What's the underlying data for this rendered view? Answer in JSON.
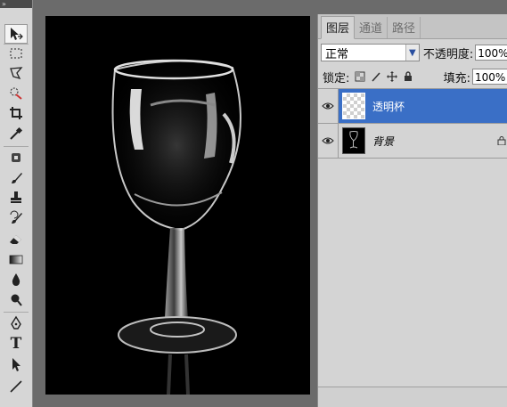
{
  "tools": [
    {
      "icon": "move-icon"
    },
    {
      "icon": "marquee-icon"
    },
    {
      "icon": "lasso-icon"
    },
    {
      "icon": "quick-selection-icon"
    },
    {
      "icon": "crop-icon"
    },
    {
      "icon": "eyedropper-icon"
    },
    {
      "icon": "healing-brush-icon"
    },
    {
      "icon": "brush-icon"
    },
    {
      "icon": "clone-stamp-icon"
    },
    {
      "icon": "history-brush-icon"
    },
    {
      "icon": "eraser-icon"
    },
    {
      "icon": "gradient-icon"
    },
    {
      "icon": "blur-icon"
    },
    {
      "icon": "dodge-icon"
    },
    {
      "icon": "pen-icon"
    },
    {
      "icon": "type-icon"
    },
    {
      "icon": "path-selection-icon"
    },
    {
      "icon": "line-icon"
    }
  ],
  "type_tool_glyph": "T",
  "panel": {
    "tabs": [
      {
        "label": "图层",
        "active": true
      },
      {
        "label": "通道",
        "active": false
      },
      {
        "label": "路径",
        "active": false
      }
    ],
    "blend_mode": "正常",
    "opacity_label": "不透明度:",
    "opacity_value": "100%",
    "lock_label": "锁定:",
    "fill_label": "填充:",
    "fill_value": "100%",
    "layers": [
      {
        "name": "透明杯",
        "selected": true,
        "visible": true
      },
      {
        "name": "背景",
        "selected": false,
        "visible": true,
        "locked": true
      }
    ]
  },
  "colors": {
    "selected_layer": "#3a6fc6",
    "panel_bg": "#d4d4d4",
    "workspace_bg": "#6b6b6b",
    "canvas_bg": "#000000"
  }
}
